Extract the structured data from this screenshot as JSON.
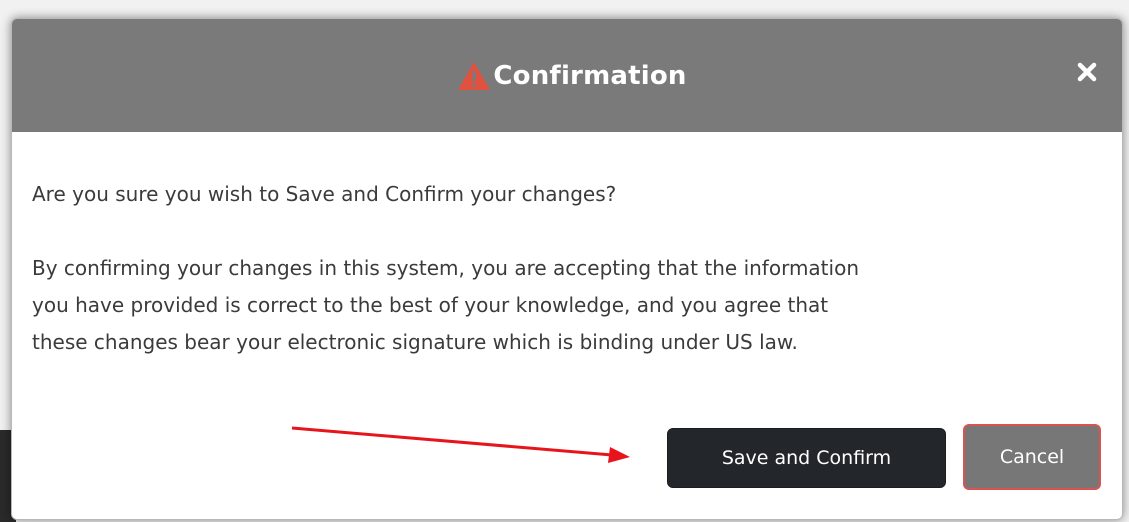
{
  "dialog": {
    "title": "Confirmation",
    "title_icon": "warning-icon",
    "close_icon": "close-icon",
    "body": {
      "question": "Are you sure you wish to Save and Confirm your changes?",
      "disclaimer_lines": [
        "By confirming your changes in this system, you are accepting that the information",
        "you have provided is correct to the best of your knowledge, and you agree that",
        "these changes bear your electronic signature which is binding under US law."
      ]
    },
    "buttons": {
      "confirm_label": "Save and Confirm",
      "cancel_label": "Cancel"
    }
  },
  "colors": {
    "header_bg": "#7a7a7a",
    "warning_icon": "#e0523f",
    "confirm_bg": "#23272b",
    "cancel_bg": "#777777",
    "cancel_border": "#d9534f",
    "annotation_arrow": "#e8141c"
  }
}
